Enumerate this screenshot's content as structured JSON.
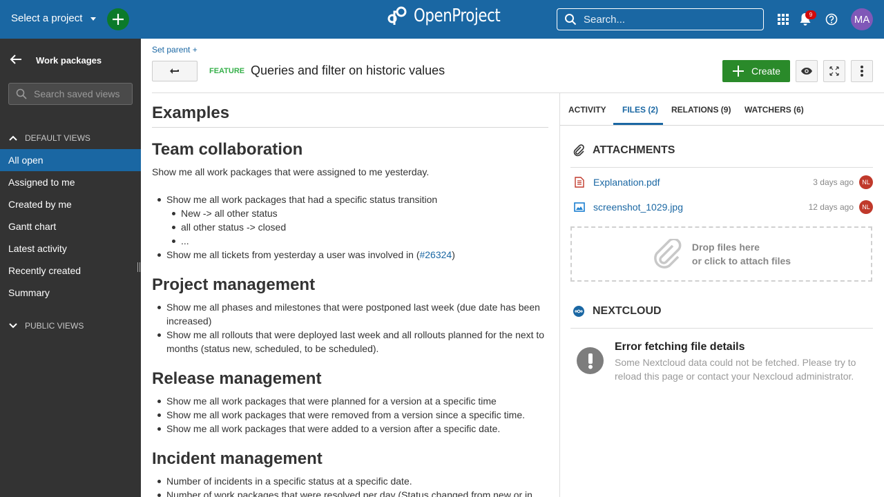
{
  "header": {
    "project_select": "Select a project",
    "logo_text": "OpenProject",
    "search_placeholder": "Search...",
    "notification_count": "9",
    "avatar_initials": "MA",
    "colors": {
      "bar": "#1a67a3",
      "add": "#0b7a2a",
      "avatar": "#8058b8",
      "badge": "#d20a0a"
    }
  },
  "sidebar": {
    "title": "Work packages",
    "search_placeholder": "Search saved views",
    "default_views_label": "DEFAULT VIEWS",
    "public_views_label": "PUBLIC VIEWS",
    "items": [
      {
        "label": "All open",
        "active": true
      },
      {
        "label": "Assigned to me"
      },
      {
        "label": "Created by me"
      },
      {
        "label": "Gantt chart"
      },
      {
        "label": "Latest activity"
      },
      {
        "label": "Recently created"
      },
      {
        "label": "Summary"
      }
    ]
  },
  "work_package": {
    "set_parent": "Set parent",
    "type": "FEATURE",
    "title": "Queries and filter on historic values",
    "create_label": "Create"
  },
  "description": {
    "heading": "Examples",
    "sections": [
      {
        "title": "Team collaboration",
        "intro": "Show me all work packages that were assigned to me yesterday.",
        "bullets": [
          "Show me all work packages that had a specific status transition",
          "Show me all tickets from yesterday a user was involved in ("
        ],
        "sub_bullets": [
          "New -> all other status",
          "all other status -> closed",
          "..."
        ],
        "link": "#26324",
        "link_close": ")"
      },
      {
        "title": "Project management",
        "bullets": [
          "Show me all phases and milestones that were postponed last week (due date has been increased)",
          "Show me all rollouts that were deployed last week and all rollouts planned for the next to months (status new, scheduled, to be scheduled)."
        ]
      },
      {
        "title": "Release management",
        "bullets": [
          "Show me all work packages that were planned for a version at a specific time",
          "Show me all work packages that were removed from a version since a specific time.",
          "Show me all work packages that were added to a version after a specific date."
        ]
      },
      {
        "title": "Incident management",
        "bullets": [
          "Number of incidents in a specific status at a specific date.",
          "Number of work packages that were resolved per day (Status changed from new or in"
        ]
      }
    ]
  },
  "panel": {
    "tabs": [
      {
        "label": "ACTIVITY"
      },
      {
        "label": "FILES (2)",
        "active": true
      },
      {
        "label": "RELATIONS (9)"
      },
      {
        "label": "WATCHERS (6)"
      }
    ],
    "attachments_title": "ATTACHMENTS",
    "attachments": [
      {
        "name": "Explanation.pdf",
        "date": "3 days ago",
        "user": "NL",
        "icon": "pdf-file-icon"
      },
      {
        "name": "screenshot_1029.jpg",
        "date": "12 days ago",
        "user": "NL",
        "icon": "image-file-icon"
      }
    ],
    "dropzone_line1": "Drop files here",
    "dropzone_line2": "or click to attach files",
    "nextcloud_title": "NEXTCLOUD",
    "error_title": "Error fetching file details",
    "error_text": "Some Nextcloud data could not be fetched. Please try to reload this page or contact your Nexcloud administrator."
  }
}
